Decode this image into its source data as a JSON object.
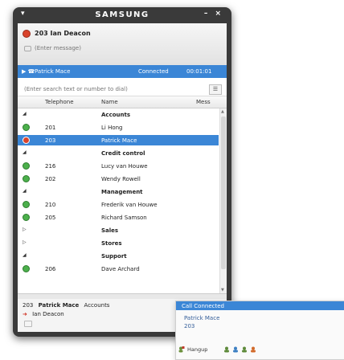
{
  "window": {
    "menu_glyph": "▾",
    "brand": "SAMSUNG",
    "controls": "– ×"
  },
  "call": {
    "caller": "203 Ian Deacon",
    "message_placeholder": "(Enter message)",
    "active": {
      "name": "Patrick Mace",
      "status": "Connected",
      "timer": "00:01:01"
    }
  },
  "search": {
    "placeholder": "(Enter search text or number to dial)"
  },
  "columns": {
    "telephone": "Telephone",
    "name": "Name",
    "message": "Mess"
  },
  "directory": [
    {
      "type": "group",
      "name": "Accounts"
    },
    {
      "type": "contact",
      "status": "green",
      "tel": "201",
      "name": "Li Hong"
    },
    {
      "type": "contact",
      "status": "red",
      "tel": "203",
      "name": "Patrick Mace",
      "selected": true
    },
    {
      "type": "group",
      "name": "Credit control"
    },
    {
      "type": "contact",
      "status": "green",
      "tel": "216",
      "name": "Lucy van Houwe"
    },
    {
      "type": "contact",
      "status": "green",
      "tel": "202",
      "name": "Wendy Rowell"
    },
    {
      "type": "group",
      "name": "Management"
    },
    {
      "type": "contact",
      "status": "green",
      "tel": "210",
      "name": "Frederik van Houwe"
    },
    {
      "type": "contact",
      "status": "green",
      "tel": "205",
      "name": "Richard Samson"
    },
    {
      "type": "group",
      "name": "Sales",
      "collapsed": true
    },
    {
      "type": "group",
      "name": "Stores",
      "collapsed": true
    },
    {
      "type": "group",
      "name": "Support"
    },
    {
      "type": "contact",
      "status": "green",
      "tel": "206",
      "name": "Dave Archard"
    }
  ],
  "footer": {
    "number": "203",
    "name": "Patrick Mace",
    "department": "Accounts",
    "transferred_from": "Ian Deacon"
  },
  "popup": {
    "header": "Call Connected",
    "name": "Patrick Mace",
    "number": "203"
  },
  "taskbar": {
    "item": "Hangup"
  },
  "colors": {
    "accent": "#3b86d6",
    "status_green": "#4cb04c",
    "status_red": "#d9432b",
    "frame": "#3a3a3a"
  }
}
